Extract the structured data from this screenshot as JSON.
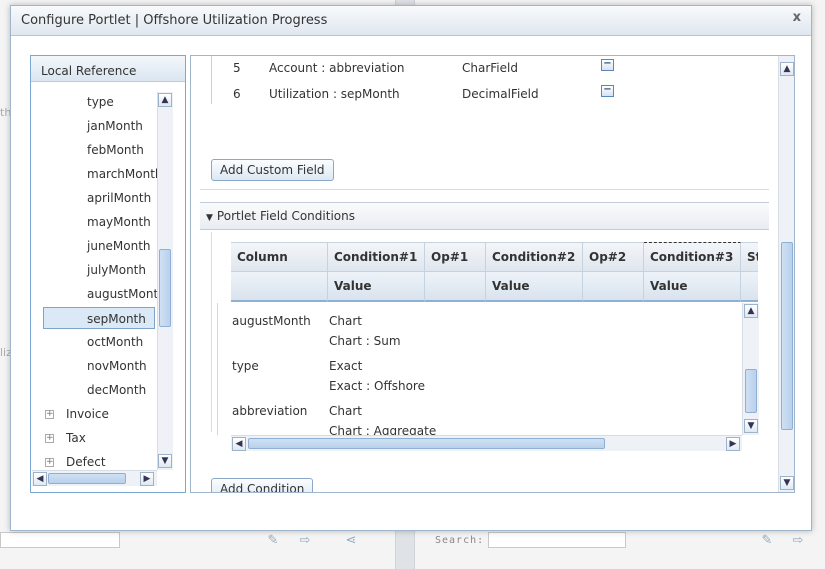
{
  "background": {
    "left_fragments": [
      "th",
      "liz"
    ],
    "search_label": "Search:",
    "icons": [
      "edit-icon",
      "export-icon",
      "share-icon",
      "edit-icon",
      "export-icon"
    ]
  },
  "modal": {
    "title": "Configure Portlet | Offshore Utilization Progress",
    "close_label": "x"
  },
  "left_panel": {
    "header": "Local Reference",
    "children": [
      "type",
      "janMonth",
      "febMonth",
      "marchMonth",
      "aprilMonth",
      "mayMonth",
      "juneMonth",
      "julyMonth",
      "augustMonth",
      "sepMonth",
      "octMonth",
      "novMonth",
      "decMonth"
    ],
    "selected": "sepMonth",
    "groups": [
      "Invoice",
      "Tax",
      "Defect"
    ],
    "expander_label": "+"
  },
  "right_panel": {
    "fields": [
      {
        "num": "5",
        "name": "Account : abbreviation",
        "type": "CharField"
      },
      {
        "num": "6",
        "name": "Utilization : sepMonth",
        "type": "DecimalField"
      }
    ],
    "remove_label": "−",
    "add_custom_field_label": "Add Custom Field",
    "section_title": "Portlet Field Conditions",
    "grid": {
      "header": [
        "Column",
        "Condition#1",
        "Op#1",
        "Condition#2",
        "Op#2",
        "Condition#3",
        "St"
      ],
      "subheader": [
        "",
        "Value",
        "",
        "Value",
        "",
        "Value",
        ""
      ]
    },
    "conditions": [
      {
        "column": "augustMonth",
        "cond": "Chart",
        "value": "Chart : Sum"
      },
      {
        "column": "type",
        "cond": "Exact",
        "value": "Exact : Offshore"
      },
      {
        "column": "abbreviation",
        "cond": "Chart",
        "value": "Chart : Aggregate"
      }
    ],
    "add_condition_label": "Add Condition"
  }
}
